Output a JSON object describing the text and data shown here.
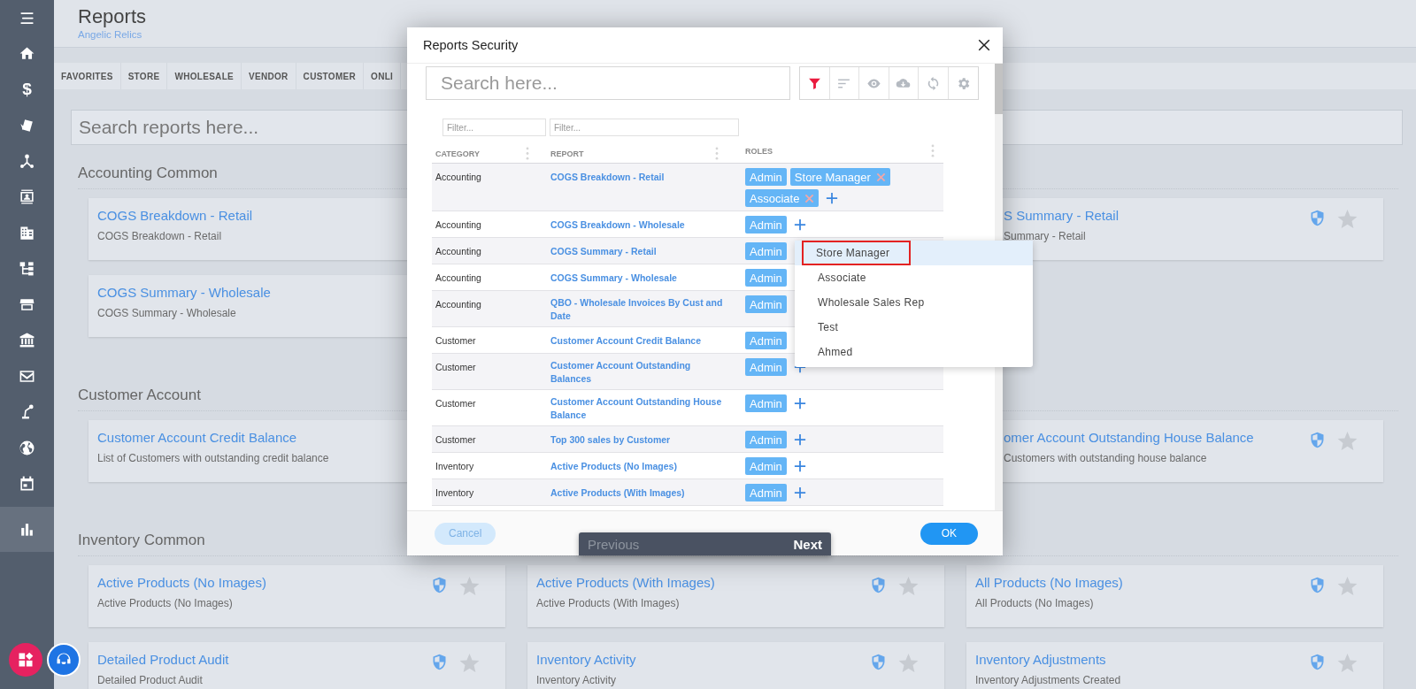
{
  "sidebar": {
    "items": [
      {
        "kind": "menu",
        "selected": false
      },
      {
        "kind": "home",
        "selected": false
      },
      {
        "kind": "dollar",
        "label": "$",
        "selected": false
      },
      {
        "kind": "tags",
        "selected": false
      },
      {
        "kind": "network",
        "selected": false
      },
      {
        "kind": "contact",
        "selected": false
      },
      {
        "kind": "building",
        "selected": false
      },
      {
        "kind": "hierarchy",
        "selected": false
      },
      {
        "kind": "store",
        "selected": false
      },
      {
        "kind": "bank",
        "selected": false
      },
      {
        "kind": "mail",
        "selected": false
      },
      {
        "kind": "robot",
        "selected": false
      },
      {
        "kind": "globe",
        "selected": false
      },
      {
        "kind": "calendar",
        "selected": false
      },
      {
        "kind": "chart",
        "selected": true
      }
    ],
    "fabs": [
      {
        "kind": "apps"
      },
      {
        "kind": "support"
      }
    ]
  },
  "header": {
    "title": "Reports",
    "subtitle": "Angelic Relics"
  },
  "tabs": [
    {
      "label": "FAVORITES",
      "selected": false
    },
    {
      "label": "STORE",
      "selected": false
    },
    {
      "label": "WHOLESALE",
      "selected": false
    },
    {
      "label": "VENDOR",
      "selected": false
    },
    {
      "label": "CUSTOMER",
      "selected": false
    },
    {
      "label": "ONLI",
      "selected": false
    }
  ],
  "search": {
    "placeholder": "Search reports here..."
  },
  "sections": [
    {
      "title": "Accounting Common",
      "rows": [
        {
          "column_1": {
            "title": "COGS Breakdown - Retail",
            "description": "COGS Breakdown - Retail"
          },
          "column_3": {
            "title": "S Summary - Retail",
            "description": "Summary - Retail",
            "favorite": false
          }
        },
        {
          "column_1": {
            "title": "COGS Summary - Wholesale",
            "description": "COGS Summary - Wholesale"
          }
        }
      ]
    },
    {
      "title": "Customer Account",
      "rows": [
        {
          "column_1": {
            "title": "Customer Account Credit Balance",
            "description": "List of Customers with outstanding credit balance"
          },
          "column_3": {
            "title": "omer Account Outstanding House Balance",
            "description": "Customers with outstanding house balance",
            "favorite": false
          }
        }
      ]
    },
    {
      "title": "Inventory Common",
      "rows": [
        {
          "column_1": {
            "title": "Active Products (No Images)",
            "description": "Active Products (No Images)",
            "favorite": false
          },
          "column_2": {
            "title": "Active Products (With Images)",
            "description": "Active Products (With Images)",
            "favorite": false
          },
          "column_3": {
            "title": "All Products (No Images)",
            "description": "All Products (No Images)",
            "favorite": false
          }
        },
        {
          "column_1": {
            "title": "Detailed Product Audit",
            "description": "Detailed Product Audit",
            "favorite": false
          },
          "column_2": {
            "title": "Inventory Activity",
            "description": "Inventory Activity",
            "favorite": false
          },
          "column_3": {
            "title": "Inventory Adjustments",
            "description": "Inventory Adjustments Created",
            "favorite": false
          }
        }
      ]
    }
  ],
  "dialog": {
    "title": "Reports Security",
    "search": {
      "placeholder": "Search here..."
    },
    "tools": [
      {
        "kind": "filter",
        "active": true
      },
      {
        "kind": "sort",
        "active": false
      },
      {
        "kind": "eye",
        "active": false
      },
      {
        "kind": "cloud",
        "active": false
      },
      {
        "kind": "sync",
        "active": false
      },
      {
        "kind": "gear",
        "active": false
      }
    ],
    "table": {
      "filters": [
        {
          "placeholder": "Filter..."
        },
        {
          "placeholder": "Filter..."
        }
      ],
      "columns": [
        "CATEGORY",
        "REPORT",
        "ROLES"
      ],
      "rows": [
        {
          "category": "Accounting",
          "report": "COGS Breakdown - Retail",
          "roles": [
            {
              "label": "Admin",
              "removable": false
            },
            {
              "label": "Store Manager",
              "removable": true
            },
            {
              "label": "Associate",
              "removable": true
            }
          ],
          "add": true
        },
        {
          "category": "Accounting",
          "report": "COGS Breakdown - Wholesale",
          "roles": [
            {
              "label": "Admin",
              "removable": false
            }
          ],
          "add": true
        },
        {
          "category": "Accounting",
          "report": "COGS Summary - Retail",
          "roles": [
            {
              "label": "Admin",
              "removable": false
            }
          ],
          "add": false
        },
        {
          "category": "Accounting",
          "report": "COGS Summary - Wholesale",
          "roles": [
            {
              "label": "Admin",
              "removable": false
            }
          ],
          "add": false
        },
        {
          "category": "Accounting",
          "report": "QBO - Wholesale Invoices By Cust and Date",
          "roles": [
            {
              "label": "Admin",
              "removable": false
            }
          ],
          "add": false
        },
        {
          "category": "Customer",
          "report": "Customer Account Credit Balance",
          "roles": [
            {
              "label": "Admin",
              "removable": false
            }
          ],
          "add": false
        },
        {
          "category": "Customer",
          "report": "Customer Account Outstanding Balances",
          "roles": [
            {
              "label": "Admin",
              "removable": false
            }
          ],
          "add": true
        },
        {
          "category": "Customer",
          "report": "Customer Account Outstanding House Balance",
          "roles": [
            {
              "label": "Admin",
              "removable": false
            }
          ],
          "add": true
        },
        {
          "category": "Customer",
          "report": "Top 300 sales by Customer",
          "roles": [
            {
              "label": "Admin",
              "removable": false
            }
          ],
          "add": true
        },
        {
          "category": "Inventory",
          "report": "Active Products (No Images)",
          "roles": [
            {
              "label": "Admin",
              "removable": false
            }
          ],
          "add": true
        },
        {
          "category": "Inventory",
          "report": "Active Products (With Images)",
          "roles": [
            {
              "label": "Admin",
              "removable": false
            }
          ],
          "add": true
        }
      ]
    },
    "dropdown": {
      "items": [
        {
          "label": "Store Manager",
          "selected": true,
          "outlined": true
        },
        {
          "label": "Associate",
          "selected": false,
          "outlined": false
        },
        {
          "label": "Wholesale Sales Rep",
          "selected": false,
          "outlined": false
        },
        {
          "label": "Test",
          "selected": false,
          "outlined": false
        },
        {
          "label": "Ahmed",
          "selected": false,
          "outlined": false
        }
      ]
    },
    "buttons": [
      {
        "label": "Cancel",
        "kind": "secondary"
      },
      {
        "label": "OK",
        "kind": "primary"
      }
    ]
  },
  "pager": [
    {
      "label": "Previous",
      "disabled": true
    },
    {
      "label": "Next",
      "disabled": false
    }
  ]
}
